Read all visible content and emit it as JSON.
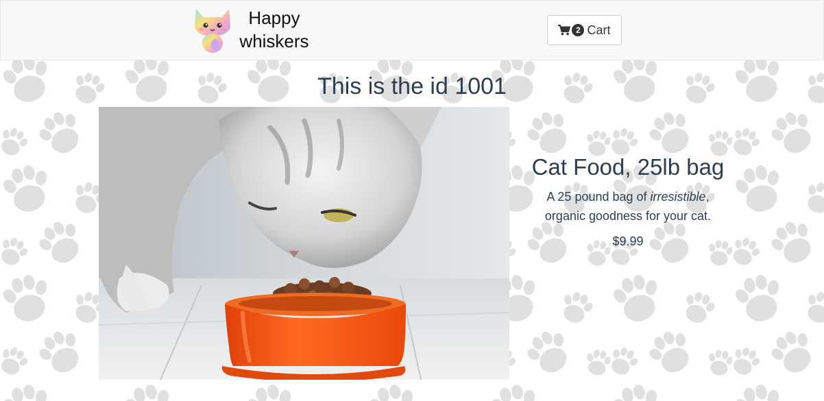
{
  "navbar": {
    "brand_line1": "Happy",
    "brand_line2": "whiskers",
    "cart_count": "2",
    "cart_label": "Cart"
  },
  "main": {
    "heading": "This is the id 1001",
    "product": {
      "title": "Cat Food, 25lb bag",
      "description_before": "A 25 pound bag of ",
      "description_emphasis": "irresistible",
      "description_after": ", organic goodness for your cat.",
      "price": "$9.99",
      "image_alt": "cat eating from an orange bowl of kibble"
    }
  },
  "icons": {
    "brand_logo": "rainbow-cat-logo-icon",
    "cart": "shopping-cart-icon",
    "background": "paw-print-icon"
  },
  "colors": {
    "navbar_bg": "#f8f8f8",
    "text": "#2c3e50",
    "paw": "#e0e0e0",
    "bowl": "#ff5a0e"
  }
}
